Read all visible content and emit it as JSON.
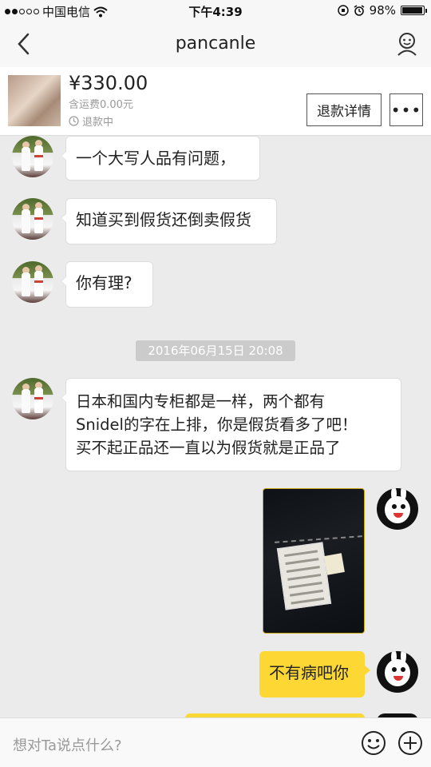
{
  "status_bar": {
    "carrier": "中国电信",
    "time": "下午4:39",
    "battery": "98%",
    "battery_level": 0.98
  },
  "nav": {
    "title": "pancanle"
  },
  "product": {
    "price": "¥330.00",
    "shipping": "含运费0.00元",
    "status": "退款中",
    "refund_button": "退款详情",
    "more_button": "•••"
  },
  "messages": [
    {
      "side": "left",
      "text": "一个大写人品有问题，"
    },
    {
      "side": "left",
      "text": "知道买到假货还倒卖假货"
    },
    {
      "side": "left",
      "text": "你有理?"
    },
    {
      "side": "left",
      "lines": [
        "日本和国内专柜都是一样，两个都有",
        "Snidel的字在上排，你是假货看多了吧！",
        "买不起正品还一直以为假货就是正品了"
      ]
    },
    {
      "side": "right",
      "type": "image"
    },
    {
      "side": "right",
      "text": "不有病吧你"
    }
  ],
  "timestamp": "2016年06月15日 20:08",
  "input": {
    "placeholder": "想对Ta说点什么?"
  },
  "colors": {
    "bubble_right": "#fdd835",
    "background": "#ebebeb"
  }
}
